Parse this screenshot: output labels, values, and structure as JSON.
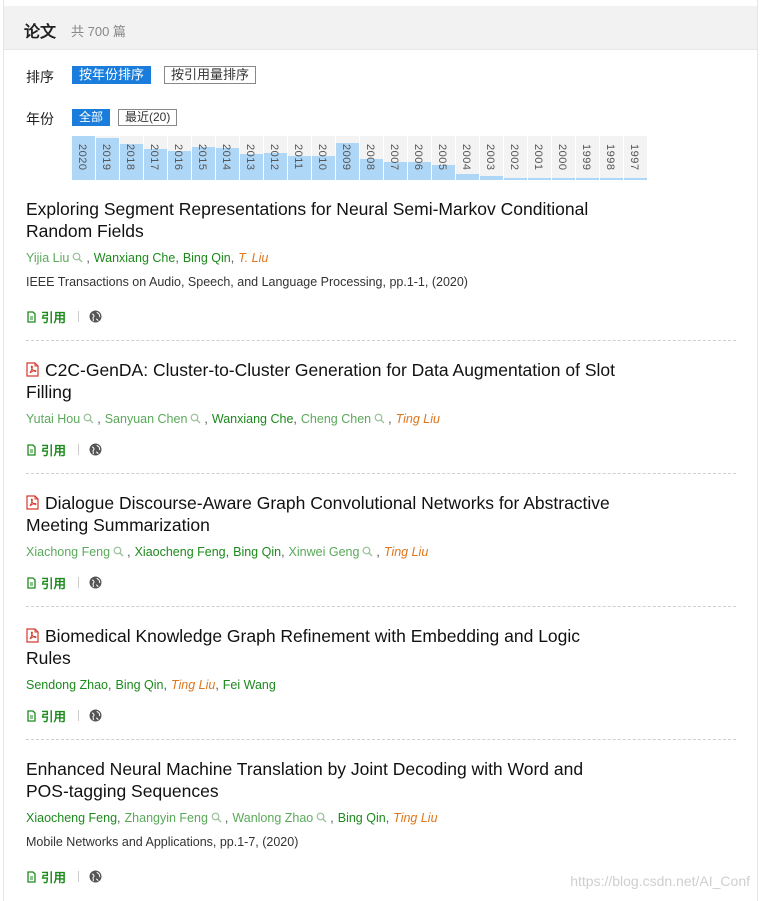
{
  "header": {
    "title": "论文",
    "count": "共 700 篇"
  },
  "sort": {
    "label": "排序",
    "options": [
      {
        "label": "按年份排序",
        "active": true
      },
      {
        "label": "按引用量排序",
        "active": false
      }
    ]
  },
  "year_filter": {
    "label": "年份",
    "options": [
      {
        "label": "全部",
        "active": true
      },
      {
        "label": "最近(20)",
        "active": false
      }
    ],
    "histogram": [
      {
        "year": "2020",
        "level": 1.0
      },
      {
        "year": "2019",
        "level": 0.95
      },
      {
        "year": "2018",
        "level": 0.82
      },
      {
        "year": "2017",
        "level": 0.7
      },
      {
        "year": "2016",
        "level": 0.65
      },
      {
        "year": "2015",
        "level": 0.75
      },
      {
        "year": "2014",
        "level": 0.72
      },
      {
        "year": "2013",
        "level": 0.6
      },
      {
        "year": "2012",
        "level": 0.62
      },
      {
        "year": "2011",
        "level": 0.55
      },
      {
        "year": "2010",
        "level": 0.55
      },
      {
        "year": "2009",
        "level": 0.85
      },
      {
        "year": "2008",
        "level": 0.48
      },
      {
        "year": "2007",
        "level": 0.4
      },
      {
        "year": "2006",
        "level": 0.4
      },
      {
        "year": "2005",
        "level": 0.35
      },
      {
        "year": "2004",
        "level": 0.14
      },
      {
        "year": "2003",
        "level": 0.1
      },
      {
        "year": "2002",
        "level": 0.0
      },
      {
        "year": "2001",
        "level": 0.0
      },
      {
        "year": "2000",
        "level": 0.0
      },
      {
        "year": "1999",
        "level": 0.0
      },
      {
        "year": "1998",
        "level": 0.0
      },
      {
        "year": "1997",
        "level": 0.0
      }
    ]
  },
  "papers": [
    {
      "title": "Exploring Segment Representations for Neural Semi-Markov Conditional Random Fields",
      "has_pdf": false,
      "authors": [
        {
          "name": "Yijia Liu",
          "style": "muted",
          "search": true
        },
        {
          "name": "Wanxiang Che",
          "style": "link",
          "search": false
        },
        {
          "name": "Bing Qin",
          "style": "link",
          "search": false
        },
        {
          "name": "T. Liu",
          "style": "corr",
          "search": false
        }
      ],
      "venue": "IEEE Transactions on Audio, Speech, and Language Processing, pp.1-1, (2020)",
      "cite_label": "引用"
    },
    {
      "title": "C2C-GenDA: Cluster-to-Cluster Generation for Data Augmentation of Slot Filling",
      "has_pdf": true,
      "authors": [
        {
          "name": "Yutai Hou",
          "style": "muted",
          "search": true
        },
        {
          "name": "Sanyuan Chen",
          "style": "muted",
          "search": true
        },
        {
          "name": "Wanxiang Che",
          "style": "link",
          "search": false
        },
        {
          "name": "Cheng Chen",
          "style": "muted",
          "search": true
        },
        {
          "name": "Ting Liu",
          "style": "corr",
          "search": false
        }
      ],
      "venue": "",
      "cite_label": "引用"
    },
    {
      "title": "Dialogue Discourse-Aware Graph Convolutional Networks for Abstractive Meeting Summarization",
      "has_pdf": true,
      "authors": [
        {
          "name": "Xiachong Feng",
          "style": "muted",
          "search": true
        },
        {
          "name": "Xiaocheng Feng",
          "style": "link",
          "search": false
        },
        {
          "name": "Bing Qin",
          "style": "link",
          "search": false
        },
        {
          "name": "Xinwei Geng",
          "style": "muted",
          "search": true
        },
        {
          "name": "Ting Liu",
          "style": "corr",
          "search": false
        }
      ],
      "venue": "",
      "cite_label": "引用"
    },
    {
      "title": "Biomedical Knowledge Graph Refinement with Embedding and Logic Rules",
      "has_pdf": true,
      "authors": [
        {
          "name": "Sendong Zhao",
          "style": "link",
          "search": false
        },
        {
          "name": "Bing Qin",
          "style": "link",
          "search": false
        },
        {
          "name": "Ting Liu",
          "style": "corr",
          "search": false
        },
        {
          "name": "Fei Wang",
          "style": "link",
          "search": false
        }
      ],
      "venue": "",
      "cite_label": "引用"
    },
    {
      "title": "Enhanced Neural Machine Translation by Joint Decoding with Word and POS-tagging Sequences",
      "has_pdf": false,
      "authors": [
        {
          "name": "Xiaocheng Feng",
          "style": "link",
          "search": false
        },
        {
          "name": "Zhangyin Feng",
          "style": "muted",
          "search": true
        },
        {
          "name": "Wanlong Zhao",
          "style": "muted",
          "search": true
        },
        {
          "name": "Bing Qin",
          "style": "link",
          "search": false
        },
        {
          "name": "Ting Liu",
          "style": "corr",
          "search": false
        }
      ],
      "venue": "Mobile Networks and Applications, pp.1-7, (2020)",
      "cite_label": "引用"
    }
  ],
  "watermark": "https://blog.csdn.net/AI_Conf",
  "colors": {
    "accent": "#1a7ddc",
    "author": "#1c8a1c",
    "corresponding": "#e0761c",
    "histogram": "#aed6f7"
  }
}
